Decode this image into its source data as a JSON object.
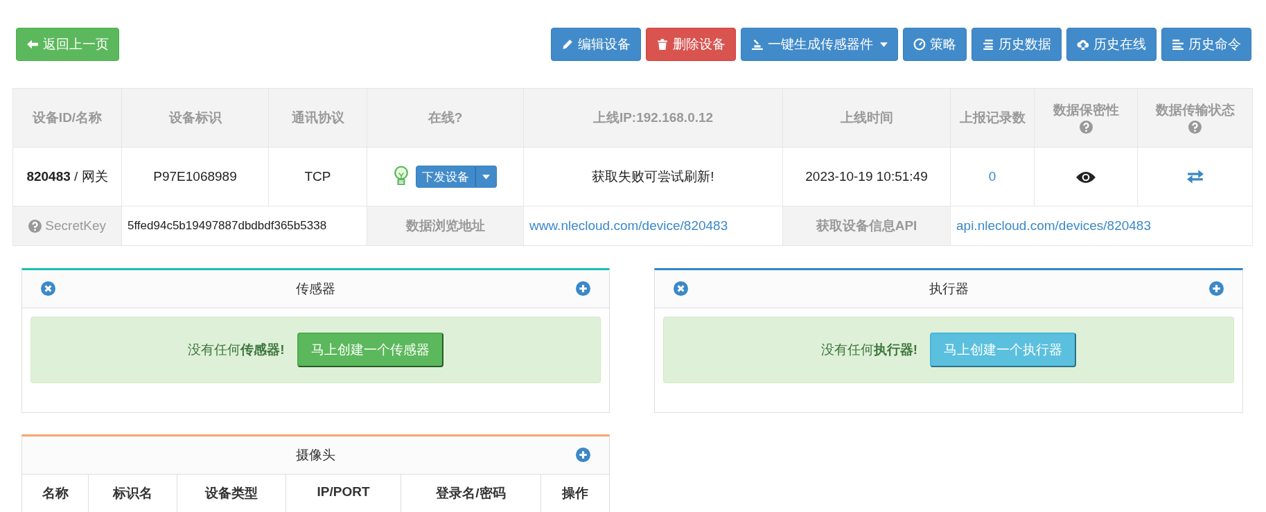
{
  "back_button": {
    "label": "返回上一页"
  },
  "toolbar": [
    {
      "label": "编辑设备",
      "kind": "edit"
    },
    {
      "label": "删除设备",
      "kind": "delete"
    },
    {
      "label": "一键生成传感器件",
      "kind": "generate"
    },
    {
      "label": "策略",
      "kind": "strategy"
    },
    {
      "label": "历史数据",
      "kind": "history_data"
    },
    {
      "label": "历史在线",
      "kind": "history_online"
    },
    {
      "label": "历史命令",
      "kind": "history_command"
    }
  ],
  "device_table": {
    "columns": [
      {
        "label": "设备ID/名称",
        "help": false
      },
      {
        "label": "设备标识",
        "help": false
      },
      {
        "label": "通讯协议",
        "help": false
      },
      {
        "label": "在线?",
        "help": false
      },
      {
        "label": "上线IP:192.168.0.12",
        "help": false
      },
      {
        "label": "上线时间",
        "help": false
      },
      {
        "label": "上报记录数",
        "help": false
      },
      {
        "label": "数据保密性",
        "help": true
      },
      {
        "label": "数据传输状态",
        "help": true
      }
    ],
    "row": {
      "id_name": "**820483** / 网关",
      "identifier": "P97E1068989",
      "protocol": "TCP",
      "online": true,
      "command_button": "下发设备",
      "ip_status": "获取失败可尝试刷新!",
      "online_time": "2023-10-19 10:51:49",
      "report_count": "0"
    },
    "info_row": [
      {
        "kind": "help_label",
        "text": "SecretKey"
      },
      {
        "kind": "value",
        "text": "5ffed94c5b19497887dbdbdf365b5338"
      },
      {
        "kind": "label",
        "text": "数据浏览地址"
      },
      {
        "kind": "link",
        "text": "www.nlecloud.com/device/820483"
      },
      {
        "kind": "label",
        "text": "获取设备信息API"
      },
      {
        "kind": "link",
        "text": "api.nlecloud.com/devices/820483"
      }
    ]
  },
  "panels": [
    {
      "title": "传感器",
      "color": "#1fbfb0",
      "closable": true,
      "empty_message": "没有任何**传感器!**",
      "create_button": "马上创建一个传感器",
      "kind": "success"
    },
    {
      "title": "执行器",
      "color": "#2b86c8",
      "closable": true,
      "empty_message": "没有任何**执行器!**",
      "create_button": "马上创建一个执行器",
      "kind": "info"
    },
    {
      "title": "摄像头",
      "color": "#f8a46c",
      "closable": false,
      "columns": [
        "名称",
        "标识名",
        "设备类型",
        "IP/PORT",
        "登录名/密码",
        "操作"
      ]
    }
  ]
}
